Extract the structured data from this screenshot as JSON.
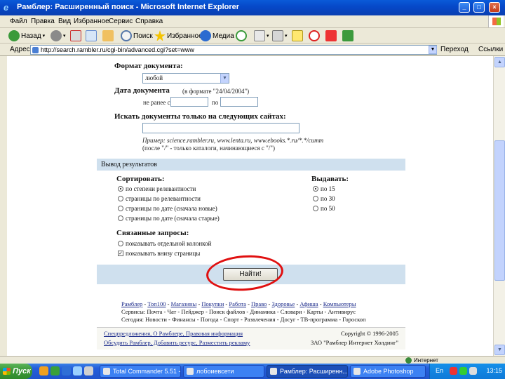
{
  "window": {
    "title": "Рамблер: Расширенный поиск - Microsoft Internet Explorer",
    "buttons": {
      "minimize": "_",
      "maximize": "□",
      "close": "×"
    }
  },
  "menu": {
    "items": [
      "Файл",
      "Правка",
      "Вид",
      "Избранное",
      "Сервис",
      "Справка"
    ]
  },
  "toolbar": {
    "back_label": "Назад",
    "search_label": "Поиск",
    "favorites_label": "Избранное",
    "media_label": "Медиа"
  },
  "addressbar": {
    "label": "Адрес",
    "url": "http://search.rambler.ru/cgi-bin/advanced.cgi?set=www",
    "go_label": "Переход",
    "links_label": "Ссылки"
  },
  "form": {
    "doc_format_label": "Формат документа:",
    "doc_format_value": "любой",
    "doc_date_label": "Дата документа",
    "doc_date_hint": "(в формате \"24/04/2004\")",
    "date_from_label": "не ранее с",
    "date_to_label": "по",
    "sites_label": "Искать документы только на следующих сайтах:",
    "sites_example": "Пример: science.rambler.ru, www.lenta.ru, www.ebooks.*.ru/*.*/cumm",
    "sites_note": "(после \"/\" - только каталоги, начинающиеся с \"/\")",
    "output_section": "Вывод результатов",
    "sort_label": "Сортировать:",
    "sort_options": [
      "по степени релевантности",
      "страницы по релевантности",
      "страницы по дате (сначала новые)",
      "страницы по дате (сначала старые)"
    ],
    "show_label": "Выдавать:",
    "show_options": [
      "по 15",
      "по 30",
      "по 50"
    ],
    "related_label": "Связанные запросы:",
    "related_options": [
      "показывать отдельной колонкой",
      "показывать внизу страницы"
    ],
    "find_button": "Найти!"
  },
  "links": {
    "line1": [
      "Рамблер",
      "Топ100",
      "Магазины",
      "Покупки",
      "Работа",
      "Право",
      "Здоровье",
      "Афиша",
      "Компьютеры"
    ],
    "line2": "Сервисы: Почта - Чат - Пейджер - Поиск файлов - Динамика - Словари - Карты - Антивирус",
    "line3": "Сегодня: Новости - Финансы - Погода - Спорт - Развлечения - Досуг - ТВ-программа - Гороскоп"
  },
  "footer": {
    "left1": "Спецпредложения, О Рамблере, Правовая информация",
    "left2": "Обсудить Рамблер, Добавить ресурс, Разместить рекламу",
    "right1": "Copyright © 1996-2005",
    "right2": "ЗАО \"Рамблер Интернет Холдинг\""
  },
  "status": {
    "zone": "Интернет"
  },
  "taskbar": {
    "start": "Пуск",
    "tasks": [
      "Total Commander 5.51 - ...",
      "лобоиевсети",
      "Рамблер: Расширенн...",
      "Adobe Photoshop"
    ],
    "lang": "En",
    "clock": "13:15"
  }
}
